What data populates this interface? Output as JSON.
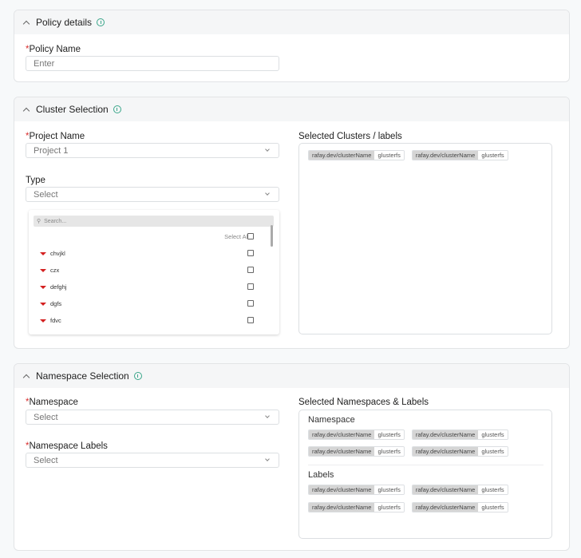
{
  "policy_details": {
    "title": "Policy details",
    "policy_name_label": "Policy Name",
    "policy_name_placeholder": "Enter"
  },
  "cluster_selection": {
    "title": "Cluster Selection",
    "project_label": "Project Name",
    "project_value": "Project 1",
    "type_label": "Type",
    "type_value": "Select",
    "search_placeholder": "Search...",
    "select_all_label": "Select All",
    "items": [
      "chvjkl",
      "czx",
      "defghj",
      "dgfs",
      "fdvc"
    ],
    "selected_title": "Selected Clusters / labels",
    "selected_tags": [
      {
        "key": "rafay.dev/clusterName",
        "value": "glusterfs"
      },
      {
        "key": "rafay.dev/clusterName",
        "value": "glusterfs"
      }
    ]
  },
  "namespace_selection": {
    "title": "Namespace Selection",
    "namespace_label": "Namespace",
    "namespace_value": "Select",
    "labels_label": "Namespace Labels",
    "labels_value": "Select",
    "selected_title": "Selected Namespaces & Labels",
    "namespace_subtitle": "Namespace",
    "labels_subtitle": "Labels",
    "namespace_tags": [
      [
        {
          "key": "rafay.dev/clusterName",
          "value": "glusterfs"
        },
        {
          "key": "rafay.dev/clusterName",
          "value": "glusterfs"
        }
      ],
      [
        {
          "key": "rafay.dev/clusterName",
          "value": "glusterfs"
        },
        {
          "key": "rafay.dev/clusterName",
          "value": "glusterfs"
        }
      ]
    ],
    "label_tags": [
      [
        {
          "key": "rafay.dev/clusterName",
          "value": "glusterfs"
        },
        {
          "key": "rafay.dev/clusterName",
          "value": "glusterfs"
        }
      ],
      [
        {
          "key": "rafay.dev/clusterName",
          "value": "glusterfs"
        },
        {
          "key": "rafay.dev/clusterName",
          "value": "glusterfs"
        }
      ]
    ]
  },
  "required_mark": "*"
}
